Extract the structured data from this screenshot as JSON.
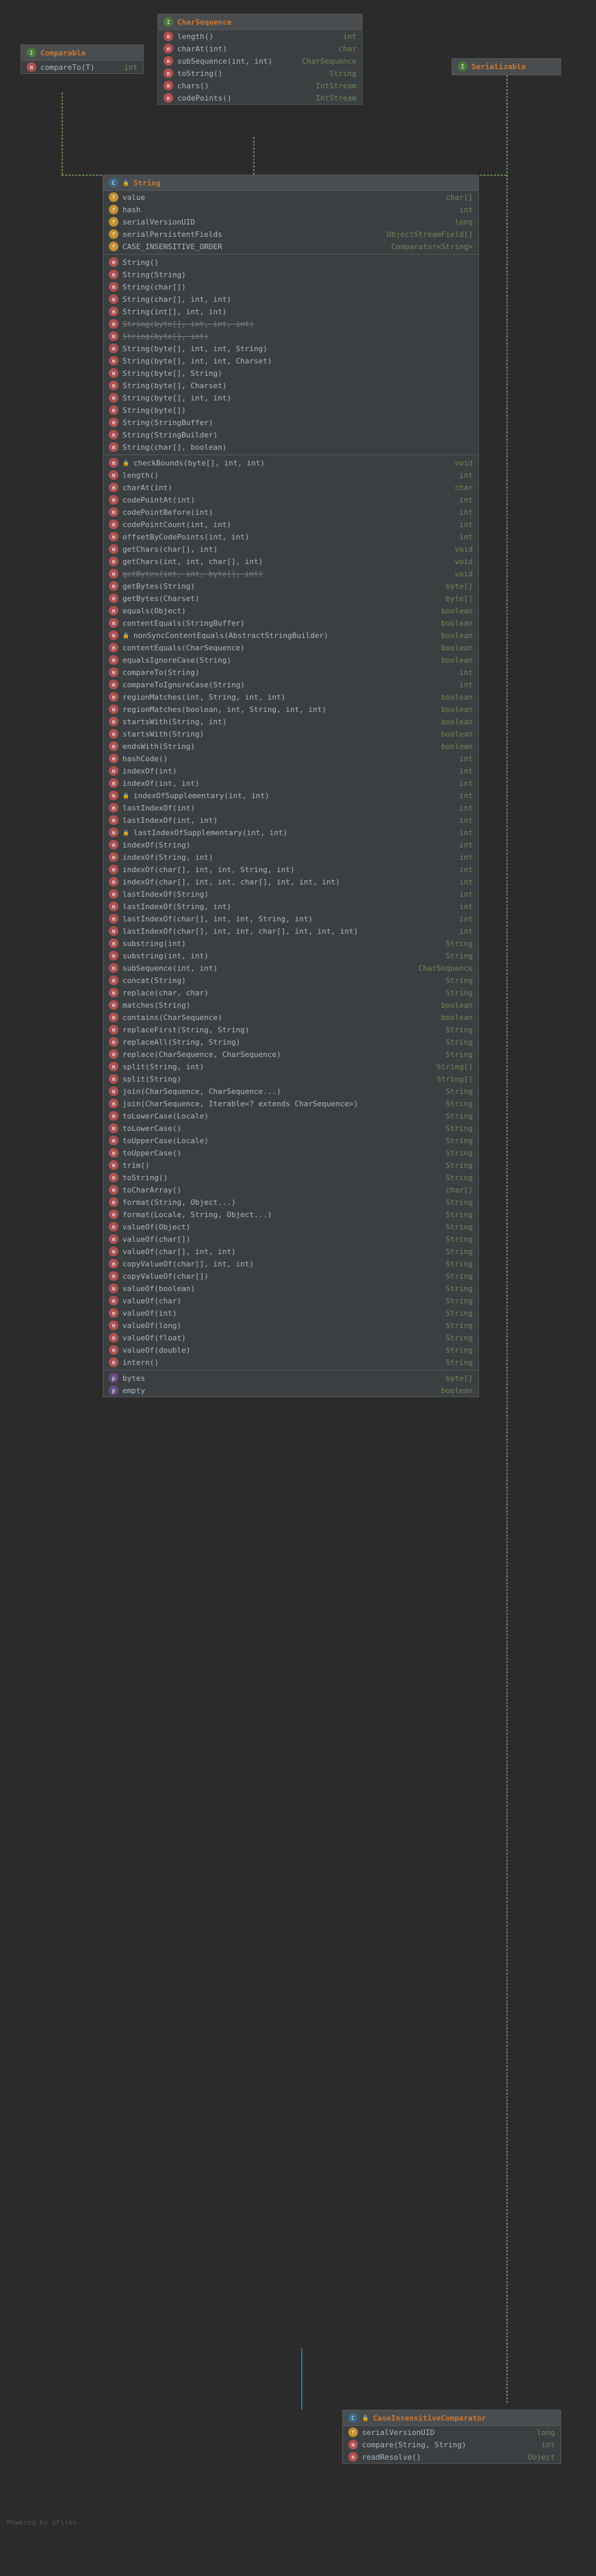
{
  "comparable": {
    "title": "Comparable",
    "m": [
      {
        "n": "compareTo(T)",
        "r": "int"
      }
    ]
  },
  "serializable": {
    "title": "Serializable"
  },
  "charseq": {
    "title": "CharSequence",
    "m": [
      {
        "n": "length()",
        "r": "int"
      },
      {
        "n": "charAt(int)",
        "r": "char"
      },
      {
        "n": "subSequence(int, int)",
        "r": "CharSequence"
      },
      {
        "n": "toString()",
        "r": "String"
      },
      {
        "n": "chars()",
        "r": "IntStream"
      },
      {
        "n": "codePoints()",
        "r": "IntStream"
      }
    ]
  },
  "string": {
    "title": "String",
    "fields": [
      {
        "i": "f",
        "n": "value",
        "r": "char[]"
      },
      {
        "i": "f",
        "n": "hash",
        "r": "int"
      },
      {
        "i": "f",
        "n": "serialVersionUID",
        "r": "long"
      },
      {
        "i": "f",
        "n": "serialPersistentFields",
        "r": "ObjectStreamField[]"
      },
      {
        "i": "f",
        "n": "CASE_INSENSITIVE_ORDER",
        "r": "Comparator<String>"
      }
    ],
    "ctors": [
      {
        "n": "String()"
      },
      {
        "n": "String(String)"
      },
      {
        "n": "String(char[])"
      },
      {
        "n": "String(char[], int, int)"
      },
      {
        "n": "String(int[], int, int)"
      },
      {
        "n": "String(byte[], int, int, int)",
        "s": 1
      },
      {
        "n": "String(byte[], int)",
        "s": 1
      },
      {
        "n": "String(byte[], int, int, String)"
      },
      {
        "n": "String(byte[], int, int, Charset)"
      },
      {
        "n": "String(byte[], String)"
      },
      {
        "n": "String(byte[], Charset)"
      },
      {
        "n": "String(byte[], int, int)"
      },
      {
        "n": "String(byte[])"
      },
      {
        "n": "String(StringBuffer)"
      },
      {
        "n": "String(StringBuilder)"
      },
      {
        "n": "String(char[], boolean)"
      }
    ],
    "methods": [
      {
        "n": "checkBounds(byte[], int, int)",
        "r": "void",
        "p": 1
      },
      {
        "n": "length()",
        "r": "int"
      },
      {
        "n": "charAt(int)",
        "r": "char"
      },
      {
        "n": "codePointAt(int)",
        "r": "int"
      },
      {
        "n": "codePointBefore(int)",
        "r": "int"
      },
      {
        "n": "codePointCount(int, int)",
        "r": "int"
      },
      {
        "n": "offsetByCodePoints(int, int)",
        "r": "int"
      },
      {
        "n": "getChars(char[], int)",
        "r": "void"
      },
      {
        "n": "getChars(int, int, char[], int)",
        "r": "void"
      },
      {
        "n": "getBytes(int, int, byte[], int)",
        "r": "void",
        "s": 1
      },
      {
        "n": "getBytes(String)",
        "r": "byte[]"
      },
      {
        "n": "getBytes(Charset)",
        "r": "byte[]"
      },
      {
        "n": "equals(Object)",
        "r": "boolean"
      },
      {
        "n": "contentEquals(StringBuffer)",
        "r": "boolean"
      },
      {
        "n": "nonSyncContentEquals(AbstractStringBuilder)",
        "r": "boolean",
        "p": 1
      },
      {
        "n": "contentEquals(CharSequence)",
        "r": "boolean"
      },
      {
        "n": "equalsIgnoreCase(String)",
        "r": "boolean"
      },
      {
        "n": "compareTo(String)",
        "r": "int"
      },
      {
        "n": "compareToIgnoreCase(String)",
        "r": "int"
      },
      {
        "n": "regionMatches(int, String, int, int)",
        "r": "boolean"
      },
      {
        "n": "regionMatches(boolean, int, String, int, int)",
        "r": "boolean"
      },
      {
        "n": "startsWith(String, int)",
        "r": "boolean"
      },
      {
        "n": "startsWith(String)",
        "r": "boolean"
      },
      {
        "n": "endsWith(String)",
        "r": "boolean"
      },
      {
        "n": "hashCode()",
        "r": "int"
      },
      {
        "n": "indexOf(int)",
        "r": "int"
      },
      {
        "n": "indexOf(int, int)",
        "r": "int"
      },
      {
        "n": "indexOfSupplementary(int, int)",
        "r": "int",
        "p": 1
      },
      {
        "n": "lastIndexOf(int)",
        "r": "int"
      },
      {
        "n": "lastIndexOf(int, int)",
        "r": "int"
      },
      {
        "n": "lastIndexOfSupplementary(int, int)",
        "r": "int",
        "p": 1
      },
      {
        "n": "indexOf(String)",
        "r": "int"
      },
      {
        "n": "indexOf(String, int)",
        "r": "int"
      },
      {
        "n": "indexOf(char[], int, int, String, int)",
        "r": "int"
      },
      {
        "n": "indexOf(char[], int, int, char[], int, int, int)",
        "r": "int"
      },
      {
        "n": "lastIndexOf(String)",
        "r": "int"
      },
      {
        "n": "lastIndexOf(String, int)",
        "r": "int"
      },
      {
        "n": "lastIndexOf(char[], int, int, String, int)",
        "r": "int"
      },
      {
        "n": "lastIndexOf(char[], int, int, char[], int, int, int)",
        "r": "int"
      },
      {
        "n": "substring(int)",
        "r": "String"
      },
      {
        "n": "substring(int, int)",
        "r": "String"
      },
      {
        "n": "subSequence(int, int)",
        "r": "CharSequence"
      },
      {
        "n": "concat(String)",
        "r": "String"
      },
      {
        "n": "replace(char, char)",
        "r": "String"
      },
      {
        "n": "matches(String)",
        "r": "boolean"
      },
      {
        "n": "contains(CharSequence)",
        "r": "boolean"
      },
      {
        "n": "replaceFirst(String, String)",
        "r": "String"
      },
      {
        "n": "replaceAll(String, String)",
        "r": "String"
      },
      {
        "n": "replace(CharSequence, CharSequence)",
        "r": "String"
      },
      {
        "n": "split(String, int)",
        "r": "String[]"
      },
      {
        "n": "split(String)",
        "r": "String[]"
      },
      {
        "n": "join(CharSequence, CharSequence...)",
        "r": "String"
      },
      {
        "n": "join(CharSequence, Iterable<? extends CharSequence>)",
        "r": "String"
      },
      {
        "n": "toLowerCase(Locale)",
        "r": "String"
      },
      {
        "n": "toLowerCase()",
        "r": "String"
      },
      {
        "n": "toUpperCase(Locale)",
        "r": "String"
      },
      {
        "n": "toUpperCase()",
        "r": "String"
      },
      {
        "n": "trim()",
        "r": "String"
      },
      {
        "n": "toString()",
        "r": "String"
      },
      {
        "n": "toCharArray()",
        "r": "char[]"
      },
      {
        "n": "format(String, Object...)",
        "r": "String"
      },
      {
        "n": "format(Locale, String, Object...)",
        "r": "String"
      },
      {
        "n": "valueOf(Object)",
        "r": "String"
      },
      {
        "n": "valueOf(char[])",
        "r": "String"
      },
      {
        "n": "valueOf(char[], int, int)",
        "r": "String"
      },
      {
        "n": "copyValueOf(char[], int, int)",
        "r": "String"
      },
      {
        "n": "copyValueOf(char[])",
        "r": "String"
      },
      {
        "n": "valueOf(boolean)",
        "r": "String"
      },
      {
        "n": "valueOf(char)",
        "r": "String"
      },
      {
        "n": "valueOf(int)",
        "r": "String"
      },
      {
        "n": "valueOf(long)",
        "r": "String"
      },
      {
        "n": "valueOf(float)",
        "r": "String"
      },
      {
        "n": "valueOf(double)",
        "r": "String"
      },
      {
        "n": "intern()",
        "r": "String"
      }
    ],
    "props": [
      {
        "i": "p",
        "n": "bytes",
        "r": "byte[]"
      },
      {
        "i": "p",
        "n": "empty",
        "r": "boolean"
      }
    ]
  },
  "cic": {
    "title": "CaseInsensitiveComparator",
    "m": [
      {
        "i": "f",
        "n": "serialVersionUID",
        "r": "long"
      },
      {
        "i": "m",
        "n": "compare(String, String)",
        "r": "int"
      },
      {
        "i": "m",
        "n": "readResolve()",
        "r": "Object"
      }
    ]
  },
  "footer": "Powered by yFiles"
}
